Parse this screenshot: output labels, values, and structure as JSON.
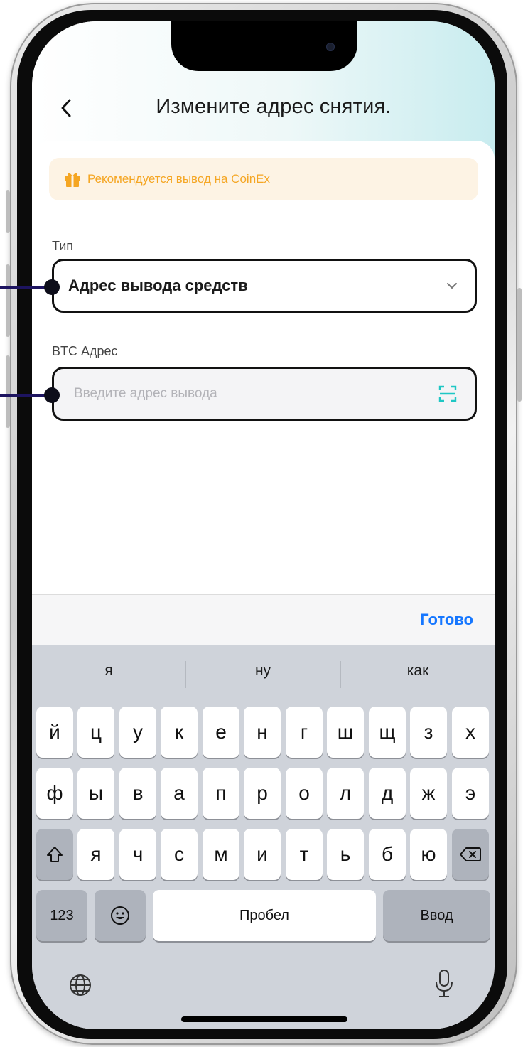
{
  "nav": {
    "title": "Измените адрес снятия.",
    "back_icon": "chevron-left-icon"
  },
  "notice": {
    "icon": "gift-icon",
    "text": "Рекомендуется вывод на CoinEx",
    "color": "#f5a623",
    "background": "#fdf3e4"
  },
  "type_field": {
    "label": "Тип",
    "value": "Адрес вывода средств",
    "icon": "chevron-down-icon"
  },
  "address_field": {
    "label": "BTC Адрес",
    "placeholder": "Введите адрес вывода",
    "icon": "scan-icon",
    "icon_color": "#1fc7c4"
  },
  "accessory": {
    "done_label": "Готово",
    "done_color": "#1677ff"
  },
  "keyboard": {
    "suggestions": [
      "я",
      "ну",
      "как"
    ],
    "row1": [
      "й",
      "ц",
      "у",
      "к",
      "е",
      "н",
      "г",
      "ш",
      "щ",
      "з",
      "х"
    ],
    "row2": [
      "ф",
      "ы",
      "в",
      "а",
      "п",
      "р",
      "о",
      "л",
      "д",
      "ж",
      "э"
    ],
    "row3": [
      "я",
      "ч",
      "с",
      "м",
      "и",
      "т",
      "ь",
      "б",
      "ю"
    ],
    "shift_icon": "shift-icon",
    "delete_icon": "delete-icon",
    "numbers_label": "123",
    "emoji_icon": "emoji-icon",
    "space_label": "Пробел",
    "return_label": "Ввод",
    "globe_icon": "globe-icon",
    "mic_icon": "microphone-icon"
  }
}
